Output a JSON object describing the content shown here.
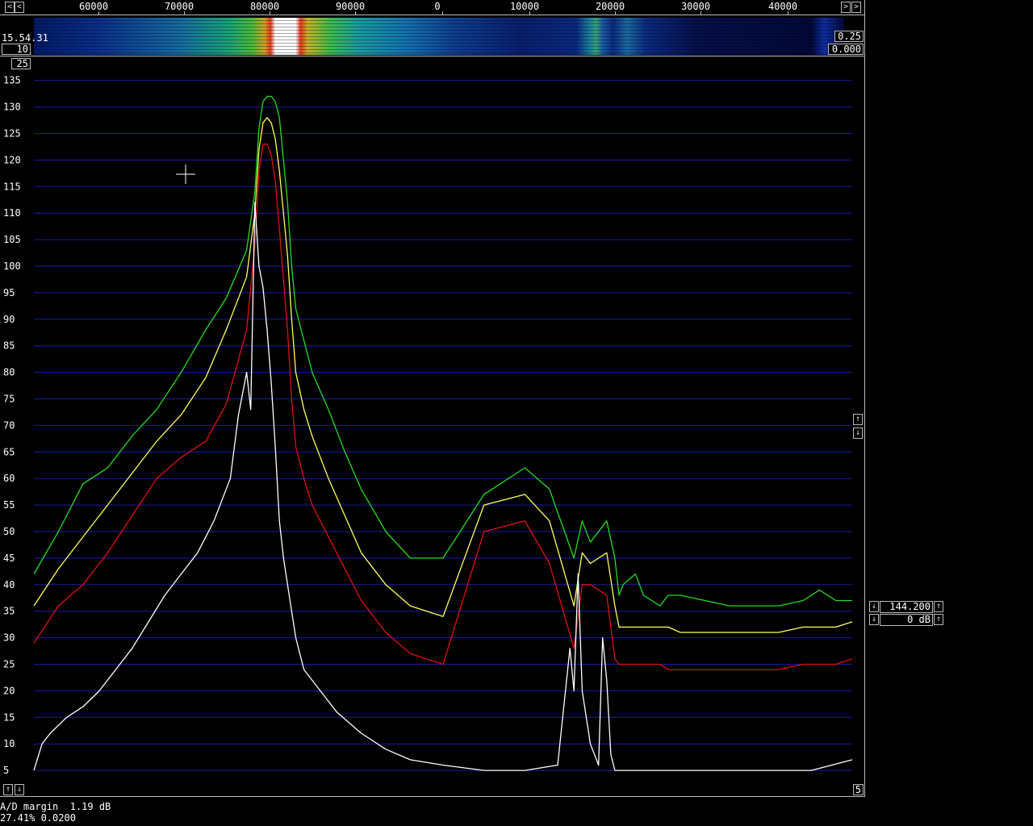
{
  "top_scale": {
    "ticks": [
      "60000",
      "70000",
      "80000",
      "90000",
      "0",
      "10000",
      "20000",
      "30000",
      "40000"
    ],
    "left_arrow": "<",
    "right_arrow": ">"
  },
  "waterfall": {
    "time": "15.54.31",
    "left_value": "10",
    "right_top_value": "0.25",
    "right_bottom_value": "0.000"
  },
  "spectrum": {
    "avg_box": "25",
    "y_labels": [
      "135",
      "130",
      "125",
      "120",
      "115",
      "110",
      "105",
      "100",
      "95",
      "90",
      "85",
      "80",
      "75",
      "70",
      "65",
      "60",
      "55",
      "50",
      "45",
      "40",
      "35",
      "30",
      "25",
      "20",
      "15",
      "10",
      "5"
    ],
    "bottom_left_up": "↑",
    "bottom_left_down": "↓",
    "bottom_right_value": "5",
    "scroll_up": "↑",
    "scroll_down": "↓"
  },
  "side_panel": {
    "frequency": "144.200",
    "gain": "0 dB",
    "arrow_up": "↑",
    "arrow_down": "↓"
  },
  "status": {
    "line1": "A/D margin  1.19 dB",
    "line2": "27.41% 0.0200"
  },
  "colors": {
    "grid": "#1a1aa6",
    "green_trace": "#22dd22",
    "yellow_trace": "#ffff55",
    "red_trace": "#e01010",
    "white_trace": "#ffffff",
    "frame": "#bbbbbb"
  },
  "chart_data": {
    "type": "line",
    "ylim": [
      0,
      138
    ],
    "y_ticks": [
      5,
      10,
      15,
      20,
      25,
      30,
      35,
      40,
      45,
      50,
      55,
      60,
      65,
      70,
      75,
      80,
      85,
      90,
      95,
      100,
      105,
      110,
      115,
      120,
      125,
      130,
      135
    ],
    "series": [
      {
        "color": "#22dd22",
        "x": [
          0,
          0.03,
          0.06,
          0.09,
          0.12,
          0.15,
          0.18,
          0.21,
          0.235,
          0.26,
          0.27,
          0.275,
          0.28,
          0.285,
          0.29,
          0.295,
          0.3,
          0.31,
          0.315,
          0.32,
          0.33,
          0.34,
          0.36,
          0.38,
          0.4,
          0.43,
          0.46,
          0.5,
          0.55,
          0.6,
          0.63,
          0.66,
          0.67,
          0.68,
          0.7,
          0.71,
          0.715,
          0.72,
          0.735,
          0.74,
          0.745,
          0.755,
          0.765,
          0.775,
          0.79,
          0.82,
          0.85,
          0.88,
          0.91,
          0.94,
          0.96,
          0.98,
          1
        ],
        "values": [
          42,
          50,
          59,
          62,
          68,
          73,
          80,
          88,
          94,
          103,
          114,
          126,
          131,
          132,
          132,
          131,
          128,
          112,
          100,
          92,
          86,
          80,
          73,
          65,
          58,
          50,
          45,
          45,
          57,
          62,
          58,
          45,
          52,
          48,
          52,
          45,
          38,
          40,
          42,
          40,
          38,
          37,
          36,
          38,
          38,
          37,
          36,
          36,
          36,
          37,
          39,
          37,
          37
        ]
      },
      {
        "color": "#ffff55",
        "x": [
          0,
          0.03,
          0.06,
          0.09,
          0.12,
          0.15,
          0.18,
          0.21,
          0.235,
          0.26,
          0.27,
          0.275,
          0.28,
          0.285,
          0.29,
          0.295,
          0.3,
          0.31,
          0.315,
          0.32,
          0.33,
          0.34,
          0.36,
          0.38,
          0.4,
          0.43,
          0.46,
          0.5,
          0.55,
          0.6,
          0.63,
          0.66,
          0.67,
          0.68,
          0.7,
          0.71,
          0.715,
          0.72,
          0.735,
          0.74,
          0.745,
          0.755,
          0.765,
          0.775,
          0.79,
          0.82,
          0.85,
          0.88,
          0.91,
          0.94,
          0.96,
          0.98,
          1
        ],
        "values": [
          36,
          43,
          49,
          55,
          61,
          67,
          72,
          79,
          88,
          98,
          110,
          122,
          127,
          128,
          127,
          124,
          118,
          102,
          90,
          80,
          73,
          68,
          60,
          53,
          46,
          40,
          36,
          34,
          55,
          57,
          52,
          36,
          46,
          44,
          46,
          36,
          32,
          32,
          32,
          32,
          32,
          32,
          32,
          32,
          31,
          31,
          31,
          31,
          31,
          32,
          32,
          32,
          33
        ]
      },
      {
        "color": "#e01010",
        "x": [
          0,
          0.03,
          0.06,
          0.09,
          0.12,
          0.15,
          0.18,
          0.21,
          0.235,
          0.26,
          0.27,
          0.275,
          0.28,
          0.285,
          0.29,
          0.295,
          0.3,
          0.31,
          0.315,
          0.32,
          0.33,
          0.34,
          0.36,
          0.38,
          0.4,
          0.43,
          0.46,
          0.5,
          0.55,
          0.6,
          0.63,
          0.66,
          0.67,
          0.68,
          0.7,
          0.71,
          0.715,
          0.72,
          0.735,
          0.74,
          0.745,
          0.755,
          0.765,
          0.775,
          0.79,
          0.82,
          0.85,
          0.88,
          0.91,
          0.94,
          0.96,
          0.98,
          1
        ],
        "values": [
          29,
          36,
          40,
          46,
          53,
          60,
          64,
          67,
          74,
          88,
          104,
          118,
          123,
          123,
          121,
          116,
          107,
          88,
          75,
          66,
          60,
          55,
          49,
          43,
          37,
          31,
          27,
          25,
          50,
          52,
          44,
          28,
          40,
          40,
          38,
          26,
          25,
          25,
          25,
          25,
          25,
          25,
          25,
          24,
          24,
          24,
          24,
          24,
          24,
          25,
          25,
          25,
          26
        ]
      },
      {
        "color": "#ffffff",
        "x": [
          0,
          0.01,
          0.02,
          0.04,
          0.06,
          0.08,
          0.1,
          0.12,
          0.14,
          0.16,
          0.18,
          0.2,
          0.22,
          0.24,
          0.25,
          0.26,
          0.265,
          0.27,
          0.275,
          0.28,
          0.285,
          0.29,
          0.295,
          0.3,
          0.305,
          0.31,
          0.315,
          0.32,
          0.33,
          0.35,
          0.37,
          0.4,
          0.43,
          0.46,
          0.5,
          0.55,
          0.6,
          0.64,
          0.655,
          0.66,
          0.665,
          0.67,
          0.68,
          0.69,
          0.695,
          0.7,
          0.705,
          0.71,
          0.72,
          0.73,
          0.74,
          0.76,
          0.8,
          0.85,
          0.9,
          0.95,
          1
        ],
        "values": [
          5,
          10,
          12,
          15,
          17,
          20,
          24,
          28,
          33,
          38,
          42,
          46,
          52,
          60,
          72,
          80,
          73,
          112,
          100,
          96,
          88,
          78,
          66,
          52,
          45,
          40,
          35,
          30,
          24,
          20,
          16,
          12,
          9,
          7,
          6,
          5,
          5,
          6,
          28,
          20,
          42,
          20,
          10,
          6,
          30,
          22,
          8,
          5,
          5,
          5,
          5,
          5,
          5,
          5,
          5,
          5,
          7
        ]
      }
    ]
  }
}
